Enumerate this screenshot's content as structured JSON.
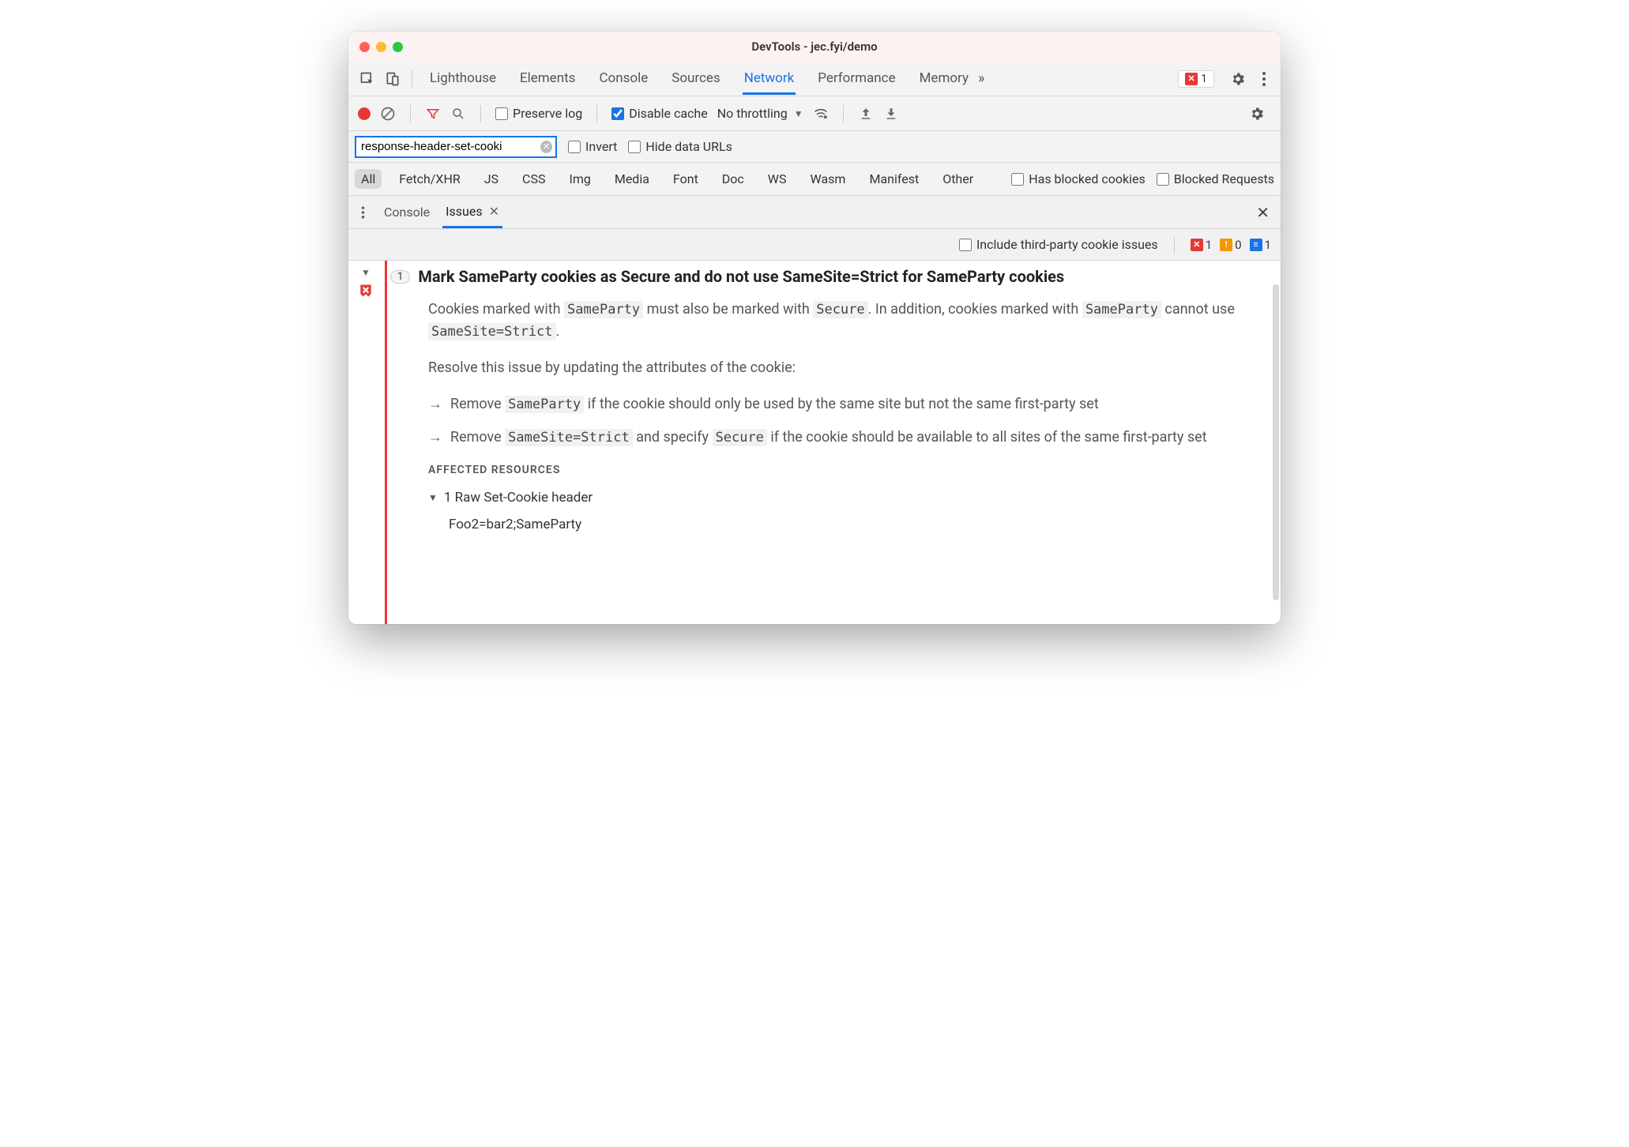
{
  "window": {
    "title": "DevTools - jec.fyi/demo"
  },
  "mainTabs": {
    "items": [
      "Lighthouse",
      "Elements",
      "Console",
      "Sources",
      "Network",
      "Performance",
      "Memory"
    ],
    "active": "Network",
    "errors": "1"
  },
  "network": {
    "preserve_label": "Preserve log",
    "disable_label": "Disable cache",
    "disable_checked": true,
    "throttling": "No throttling"
  },
  "filter": {
    "value": "response-header-set-cooki",
    "invert_label": "Invert",
    "hide_label": "Hide data URLs"
  },
  "types": {
    "items": [
      "All",
      "Fetch/XHR",
      "JS",
      "CSS",
      "Img",
      "Media",
      "Font",
      "Doc",
      "WS",
      "Wasm",
      "Manifest",
      "Other"
    ],
    "active": "All",
    "blocked_cookies_label": "Has blocked cookies",
    "blocked_requests_label": "Blocked Requests"
  },
  "drawer": {
    "tabs": [
      "Console",
      "Issues"
    ],
    "active": "Issues"
  },
  "issuesBar": {
    "include_label": "Include third-party cookie issues",
    "counts": {
      "error": "1",
      "warn": "0",
      "info": "1"
    }
  },
  "issue": {
    "count": "1",
    "title": "Mark SameParty cookies as Secure and do not use SameSite=Strict for SameParty cookies",
    "p1_a": "Cookies marked with ",
    "p1_b": " must also be marked with ",
    "p1_c": ". In addition, cookies marked with ",
    "p1_d": " cannot use ",
    "p1_e": ".",
    "code_sameparty": "SameParty",
    "code_secure": "Secure",
    "code_samesite": "SameSite=Strict",
    "p2": "Resolve this issue by updating the attributes of the cookie:",
    "b1_a": "Remove ",
    "b1_b": " if the cookie should only be used by the same site but not the same first-party set",
    "b2_a": "Remove ",
    "b2_b": " and specify ",
    "b2_c": " if the cookie should be available to all sites of the same first-party set",
    "affected_label": "AFFECTED RESOURCES",
    "raw_header_label": "1 Raw Set-Cookie header",
    "raw_value": "Foo2=bar2;SameParty"
  }
}
